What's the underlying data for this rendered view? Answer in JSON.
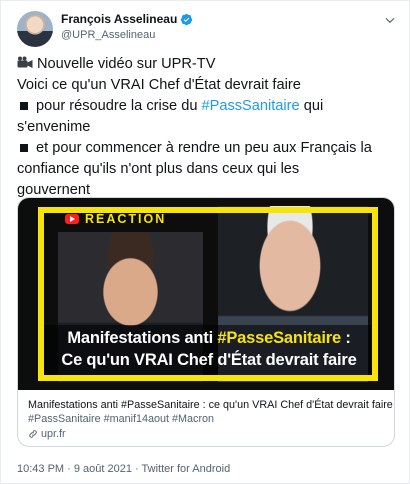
{
  "author": {
    "display_name": "François Asselineau",
    "handle": "@UPR_Asselineau",
    "verified": true
  },
  "tweet": {
    "line1": "Nouvelle vidéo sur UPR-TV",
    "line2": "Voici ce qu'un VRAI Chef d'État devrait faire",
    "bullet1_prefix": "pour résoudre la crise du ",
    "bullet1_hashtag": "#PassSanitaire",
    "bullet1_suffix": " qui",
    "bullet1_cont": "s'envenime",
    "bullet2_line1": "et pour commencer à rendre un peu aux Français la",
    "bullet2_line2": "confiance qu'ils n'ont plus dans ceux qui les",
    "bullet2_line3": "gouvernent"
  },
  "card": {
    "reaction_label": "RÉACTION",
    "overlay_prefix": "Manifestations anti ",
    "overlay_hashtag": "#PasseSanitaire",
    "overlay_suffix": " :",
    "overlay_line2": "Ce qu'un VRAI Chef d'État devrait faire",
    "link_title": "Manifestations anti #PasseSanitaire : ce qu'un VRAI Chef d'État devrait faire - UPR",
    "link_tags": "#PassSanitaire #manif14aout #Macron",
    "link_domain": "upr.fr"
  },
  "footer": {
    "timestamp": "10:43 PM · 9 août 2021 · Twitter for Android"
  },
  "colors": {
    "accent": "#1d9bf0",
    "frame_yellow": "#f7e40a"
  },
  "icons": [
    "verified-icon",
    "chevron-down-icon",
    "video-camera-icon",
    "link-icon",
    "youtube-icon"
  ]
}
